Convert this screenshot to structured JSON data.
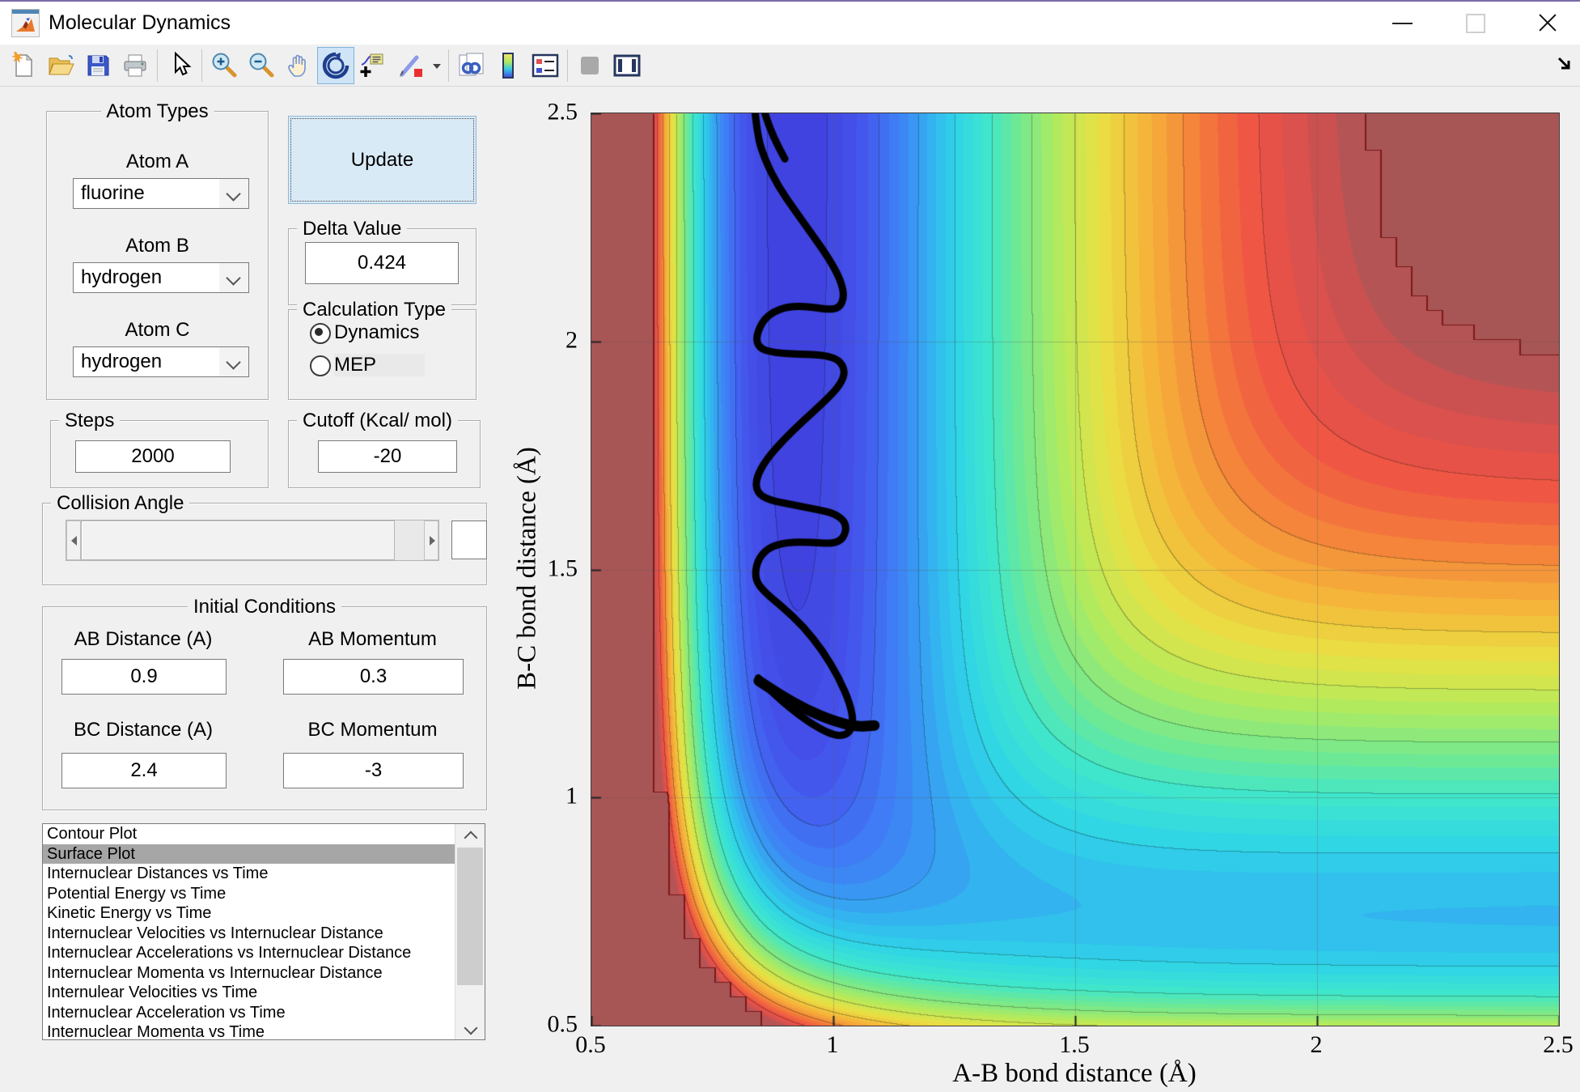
{
  "window": {
    "title": "Molecular Dynamics"
  },
  "toolbar": {
    "items": [
      {
        "name": "new-file-icon"
      },
      {
        "name": "open-file-icon"
      },
      {
        "name": "save-icon"
      },
      {
        "name": "print-icon"
      },
      {
        "sep": true
      },
      {
        "name": "pointer-icon"
      },
      {
        "sep": true
      },
      {
        "name": "zoom-in-icon"
      },
      {
        "name": "zoom-out-icon"
      },
      {
        "name": "pan-icon"
      },
      {
        "name": "rotate-3d-icon",
        "active": true
      },
      {
        "name": "data-cursor-icon"
      },
      {
        "name": "brush-icon"
      },
      {
        "name": "brush-dropdown-icon",
        "narrow": true
      },
      {
        "sep": true
      },
      {
        "name": "link-plots-icon"
      },
      {
        "name": "insert-colorbar-icon"
      },
      {
        "name": "insert-legend-icon"
      },
      {
        "sep": true
      },
      {
        "name": "hide-plot-tools-icon"
      },
      {
        "name": "show-plot-tools-icon"
      }
    ]
  },
  "atom_types": {
    "title": "Atom Types",
    "fields": [
      {
        "label": "Atom A",
        "value": "fluorine"
      },
      {
        "label": "Atom B",
        "value": "hydrogen"
      },
      {
        "label": "Atom C",
        "value": "hydrogen"
      }
    ]
  },
  "update_label": "Update",
  "delta": {
    "title": "Delta Value",
    "value": "0.424"
  },
  "calculation": {
    "title": "Calculation Type",
    "options": [
      {
        "label": "Dynamics",
        "selected": true
      },
      {
        "label": "MEP",
        "selected": false
      }
    ]
  },
  "steps": {
    "title": "Steps",
    "value": "2000"
  },
  "cutoff": {
    "title": "Cutoff (Kcal/ mol)",
    "value": "-20"
  },
  "collision": {
    "title": "Collision Angle",
    "edit_value": ""
  },
  "initial": {
    "title": "Initial Conditions",
    "fields": [
      {
        "label": "AB Distance (A)",
        "value": "0.9"
      },
      {
        "label": "AB Momentum",
        "value": "0.3"
      },
      {
        "label": "BC Distance (A)",
        "value": "2.4"
      },
      {
        "label": "BC Momentum",
        "value": "-3"
      }
    ]
  },
  "plot_list": {
    "selected_index": 1,
    "items": [
      "Contour Plot",
      "Surface Plot",
      "Internuclear Distances vs Time",
      "Potential Energy vs Time",
      "Kinetic Energy vs Time",
      "Internuclear Velocities vs Internuclear Distance",
      "Internuclear Accelerations vs Internuclear Distance",
      "Internuclear Momenta vs Internuclear Distance",
      "Internulear Velocities vs Time",
      "Internuclear Acceleration vs Time",
      "Internuclear Momenta vs Time"
    ]
  },
  "plot": {
    "xlabel": "A-B bond distance (Å)",
    "ylabel": "B-C bond distance (Å)",
    "xlim": [
      0.5,
      2.5
    ],
    "ylim": [
      0.5,
      2.5
    ],
    "xticks": [
      "0.5",
      "1",
      "1.5",
      "2",
      "2.5"
    ],
    "yticks": [
      "2.5",
      "2",
      "1.5",
      "1",
      "0.5"
    ],
    "grid": true,
    "surface": {
      "type": "LEPS-collinear-filled-contour",
      "pairs": {
        "AB": {
          "D": 141,
          "a": 2.22,
          "re": 0.92
        },
        "BC": {
          "D": 109,
          "a": 1.94,
          "re": 0.74
        },
        "AC": {
          "D": 141,
          "a": 2.22,
          "re": 0.92
        }
      },
      "sato": 0.17,
      "v_min": -150,
      "v_cap": -20,
      "bands": 44,
      "line_every": 4,
      "cell": 0.032
    },
    "colormap": [
      [
        0.0,
        "#3a3ac8"
      ],
      [
        0.07,
        "#4040dd"
      ],
      [
        0.15,
        "#4458ee"
      ],
      [
        0.22,
        "#3f7ef5"
      ],
      [
        0.3,
        "#33aff0"
      ],
      [
        0.36,
        "#2fd3e8"
      ],
      [
        0.44,
        "#3ee6cd"
      ],
      [
        0.52,
        "#74e98e"
      ],
      [
        0.6,
        "#b2ea5e"
      ],
      [
        0.68,
        "#e8e243"
      ],
      [
        0.76,
        "#f5b63a"
      ],
      [
        0.84,
        "#f47c3a"
      ],
      [
        0.9,
        "#ef5345"
      ],
      [
        0.96,
        "#d05050"
      ],
      [
        1.0,
        "#a85555"
      ]
    ],
    "plateau_color": "#a85555",
    "plateau_line": "#7a1a1a",
    "grid_color": "rgba(90,90,90,0.3)",
    "trajectory": {
      "color": "#000000",
      "segments": [
        {
          "width": 9,
          "pts": [
            [
              0.9,
              2.4
            ],
            [
              0.873,
              2.452
            ],
            [
              0.85,
              2.53
            ]
          ]
        },
        {
          "width": 9,
          "pts": [
            [
              0.836,
              2.53
            ],
            [
              0.842,
              2.455
            ],
            [
              0.858,
              2.4
            ],
            [
              0.886,
              2.34
            ],
            [
              0.922,
              2.285
            ],
            [
              0.958,
              2.232
            ],
            [
              0.992,
              2.18
            ],
            [
              1.015,
              2.135
            ],
            [
              1.023,
              2.098
            ],
            [
              1.012,
              2.072
            ],
            [
              0.985,
              2.07
            ],
            [
              0.94,
              2.078
            ],
            [
              0.895,
              2.075
            ],
            [
              0.858,
              2.052
            ],
            [
              0.84,
              2.012
            ],
            [
              0.846,
              1.985
            ],
            [
              0.878,
              1.975
            ],
            [
              0.93,
              1.972
            ],
            [
              0.98,
              1.97
            ],
            [
              1.012,
              1.96
            ],
            [
              1.025,
              1.935
            ],
            [
              1.015,
              1.905
            ],
            [
              0.982,
              1.868
            ],
            [
              0.94,
              1.828
            ],
            [
              0.898,
              1.785
            ],
            [
              0.862,
              1.742
            ],
            [
              0.84,
              1.7
            ],
            [
              0.842,
              1.668
            ],
            [
              0.868,
              1.652
            ],
            [
              0.915,
              1.642
            ],
            [
              0.965,
              1.632
            ],
            [
              1.005,
              1.622
            ],
            [
              1.028,
              1.6
            ],
            [
              1.022,
              1.568
            ],
            [
              0.998,
              1.556
            ],
            [
              0.952,
              1.56
            ],
            [
              0.905,
              1.56
            ],
            [
              0.865,
              1.548
            ],
            [
              0.842,
              1.518
            ],
            [
              0.838,
              1.478
            ],
            [
              0.858,
              1.45
            ],
            [
              0.895,
              1.418
            ],
            [
              0.938,
              1.375
            ],
            [
              0.978,
              1.322
            ],
            [
              1.012,
              1.262
            ],
            [
              1.035,
              1.205
            ],
            [
              1.042,
              1.162
            ],
            [
              1.03,
              1.138
            ],
            [
              1.005,
              1.135
            ],
            [
              0.97,
              1.152
            ],
            [
              0.93,
              1.18
            ],
            [
              0.892,
              1.213
            ],
            [
              0.862,
              1.243
            ],
            [
              0.845,
              1.262
            ]
          ]
        },
        {
          "width": 13,
          "pts": [
            [
              0.846,
              1.256
            ],
            [
              0.89,
              1.225
            ],
            [
              0.945,
              1.192
            ],
            [
              1.0,
              1.168
            ],
            [
              1.048,
              1.155
            ],
            [
              1.085,
              1.158
            ]
          ]
        }
      ]
    }
  }
}
